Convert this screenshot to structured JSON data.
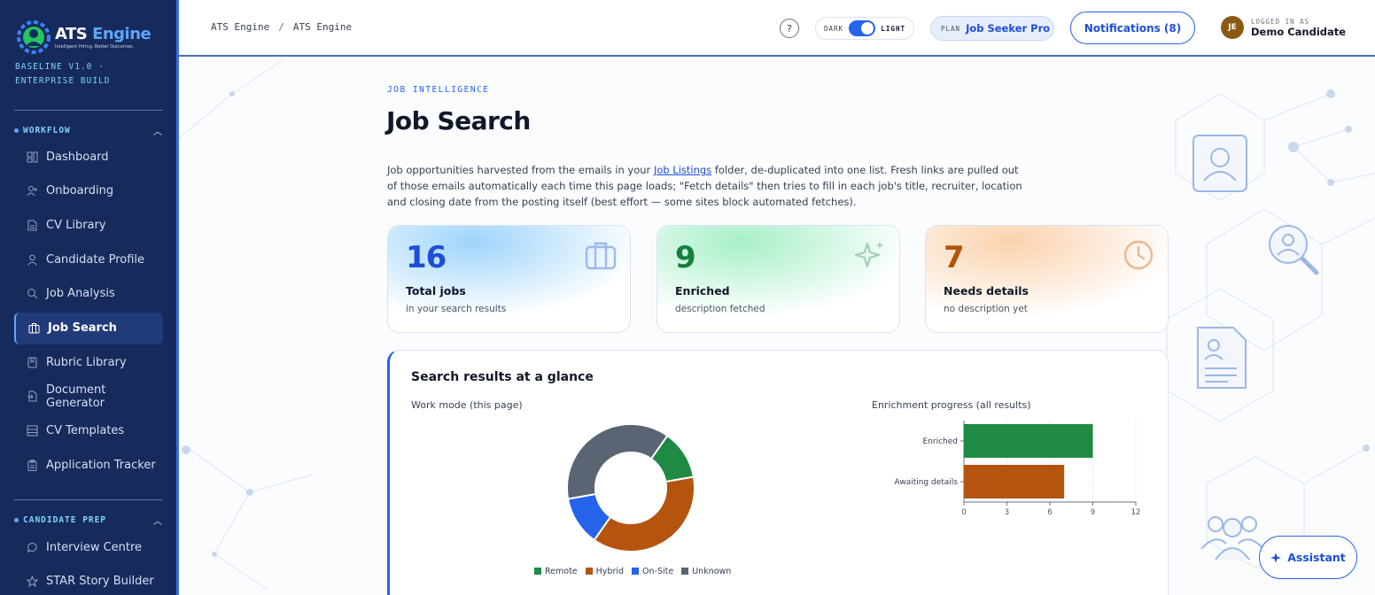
{
  "brand": {
    "name_part1": "ATS",
    "name_part2": "Engine",
    "tagline": "Intelligent Hiring. Better Outcomes.",
    "build": "BASELINE V1.0 · ENTERPRISE BUILD"
  },
  "sidebar": {
    "workflow_label": "WORKFLOW",
    "workflow": [
      {
        "label": "Dashboard",
        "icon": "dashboard-icon"
      },
      {
        "label": "Onboarding",
        "icon": "user-plus-icon"
      },
      {
        "label": "CV Library",
        "icon": "document-icon"
      },
      {
        "label": "Candidate Profile",
        "icon": "user-icon"
      },
      {
        "label": "Job Analysis",
        "icon": "search-icon"
      },
      {
        "label": "Job Search",
        "icon": "briefcase-icon",
        "active": true
      },
      {
        "label": "Rubric Library",
        "icon": "book-icon"
      },
      {
        "label": "Document Generator",
        "icon": "file-export-icon"
      },
      {
        "label": "CV Templates",
        "icon": "layout-icon"
      },
      {
        "label": "Application Tracker",
        "icon": "clipboard-icon"
      }
    ],
    "prep_label": "CANDIDATE PREP",
    "prep": [
      {
        "label": "Interview Centre",
        "icon": "chat-icon"
      },
      {
        "label": "STAR Story Builder",
        "icon": "star-icon"
      }
    ]
  },
  "topbar": {
    "breadcrumb": [
      "ATS Engine",
      "ATS Engine"
    ],
    "help": "?",
    "theme_dark": "DARK",
    "theme_light": "LIGHT",
    "theme_selected": "LIGHT",
    "plan_label": "PLAN",
    "plan_value": "Job Seeker Pro",
    "notifications": "Notifications (8)",
    "user_label": "LOGGED IN AS",
    "user_name": "Demo Candidate",
    "user_initials": "JE"
  },
  "page": {
    "eyebrow": "JOB INTELLIGENCE",
    "title": "Job Search",
    "intro_before": "Job opportunities harvested from the emails in your ",
    "intro_link": "Job Listings",
    "intro_after": " folder, de-duplicated into one list. Fresh links are pulled out of those emails automatically each time this page loads; \"Fetch details\" then tries to fill in each job's title, recruiter, location and closing date from the posting itself (best effort — some sites block automated fetches)."
  },
  "stats": [
    {
      "value": "16",
      "label": "Total jobs",
      "sub": "in your search results",
      "color": "#1d4ed8",
      "icon": "briefcase-icon"
    },
    {
      "value": "9",
      "label": "Enriched",
      "sub": "description fetched",
      "color": "#15803d",
      "icon": "sparkle-icon"
    },
    {
      "value": "7",
      "label": "Needs details",
      "sub": "no description yet",
      "color": "#b45309",
      "icon": "clock-icon"
    }
  ],
  "panel": {
    "title": "Search results at a glance",
    "donut_title": "Work mode (this page)",
    "bar_title": "Enrichment progress (all results)"
  },
  "chart_data": [
    {
      "type": "pie",
      "title": "Work mode (this page)",
      "categories": [
        "Remote",
        "Hybrid",
        "On-Site",
        "Unknown"
      ],
      "values": [
        2,
        6,
        2,
        6
      ],
      "colors": [
        "#1e8a43",
        "#b5540f",
        "#2563eb",
        "#5b6473"
      ]
    },
    {
      "type": "bar",
      "orientation": "horizontal",
      "title": "Enrichment progress (all results)",
      "categories": [
        "Enriched",
        "Awaiting details"
      ],
      "values": [
        9,
        7
      ],
      "colors": [
        "#1e8a43",
        "#b5540f"
      ],
      "xlim": [
        0,
        12
      ],
      "xticks": [
        "0",
        "3",
        "6",
        "9",
        "12"
      ],
      "grid": true
    }
  ],
  "assistant": {
    "label": "Assistant"
  }
}
